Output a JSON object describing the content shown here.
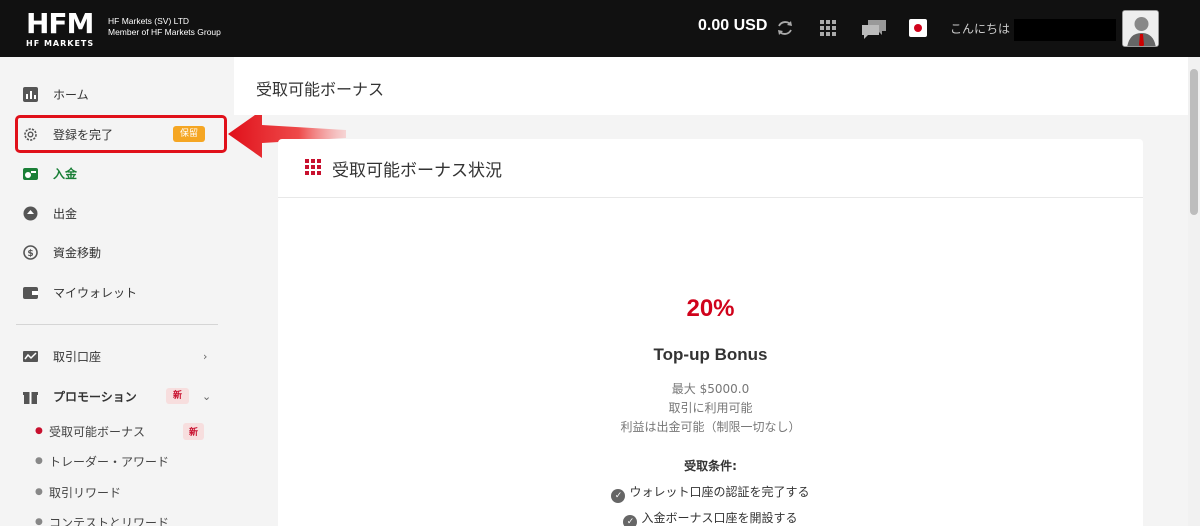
{
  "header": {
    "logo_text": "HFM",
    "logo_subtext": "HF MARKETS",
    "company_line1": "HF Markets (SV) LTD",
    "company_line2": "Member of HF Markets Group",
    "balance": "0.00 USD",
    "greeting": "こんにちは",
    "icons": [
      "refresh-icon",
      "apps-grid-icon",
      "chat-icon",
      "japan-flag-icon",
      "avatar"
    ]
  },
  "sidebar": {
    "items": [
      {
        "label": "ホーム",
        "icon": "chart-icon"
      },
      {
        "label": "登録を完了",
        "icon": "gear-icon",
        "badge": "保留"
      },
      {
        "label": "入金",
        "icon": "deposit-icon"
      },
      {
        "label": "出金",
        "icon": "withdraw-icon"
      },
      {
        "label": "資金移動",
        "icon": "transfer-icon"
      },
      {
        "label": "マイウォレット",
        "icon": "wallet-icon"
      },
      {
        "label": "取引口座",
        "icon": "trading-icon"
      },
      {
        "label": "プロモーション",
        "icon": "gift-icon",
        "badge": "新"
      }
    ],
    "sub_items": [
      {
        "label": "受取可能ボーナス",
        "badge": "新",
        "active": true
      },
      {
        "label": "トレーダー・アワード"
      },
      {
        "label": "取引リワード"
      },
      {
        "label": "コンテストとリワード"
      }
    ]
  },
  "main": {
    "page_title": "受取可能ボーナス",
    "card_title": "受取可能ボーナス状況",
    "bonus_percent": "20%",
    "bonus_name": "Top-up Bonus",
    "details": [
      "最大 $5000.0",
      "取引に利用可能",
      "利益は出金可能（制限一切なし）"
    ],
    "conditions_title": "受取条件:",
    "conditions": [
      "ウォレット口座の認証を完了する",
      "入金ボーナス口座を開設する"
    ]
  },
  "colors": {
    "accent_red": "#d0021b",
    "pending_orange": "#f5a623",
    "deposit_green": "#1a7f37",
    "topbar": "#111111"
  }
}
